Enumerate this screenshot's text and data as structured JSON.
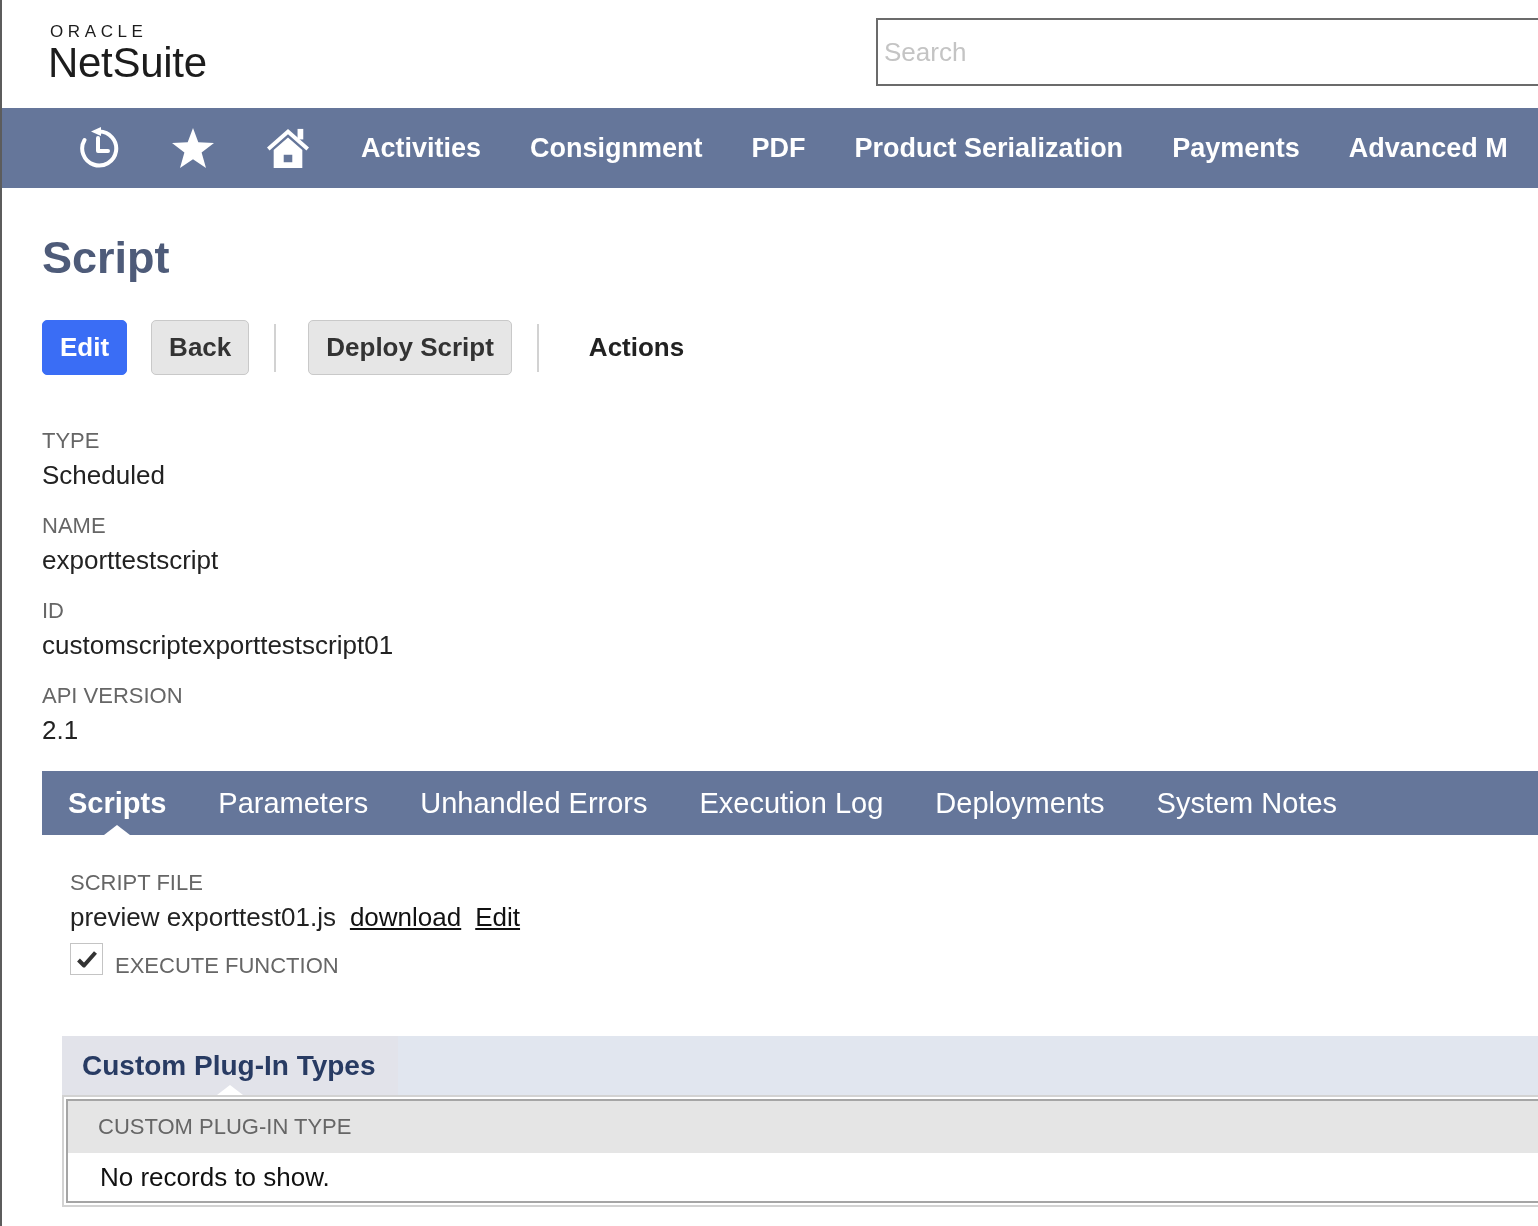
{
  "logo": {
    "company": "ORACLE",
    "product": "NetSuite"
  },
  "search": {
    "placeholder": "Search"
  },
  "nav": {
    "items": [
      "Activities",
      "Consignment",
      "PDF",
      "Product Serialization",
      "Payments",
      "Advanced M"
    ]
  },
  "page": {
    "title": "Script"
  },
  "buttons": [
    {
      "label": "Edit",
      "kind": "primary",
      "separated": false
    },
    {
      "label": "Back",
      "kind": "secondary",
      "separated": false
    },
    {
      "label": "Deploy Script",
      "kind": "secondary",
      "separated": true
    },
    {
      "label": "Actions",
      "kind": "menu",
      "separated": true
    }
  ],
  "fields": [
    {
      "label": "TYPE",
      "value": "Scheduled"
    },
    {
      "label": "NAME",
      "value": "exporttestscript"
    },
    {
      "label": "ID",
      "value": "customscriptexporttestscript01"
    },
    {
      "label": "API VERSION",
      "value": "2.1"
    }
  ],
  "subtabs": [
    {
      "label": "Scripts",
      "selected": true
    },
    {
      "label": "Parameters",
      "selected": false
    },
    {
      "label": "Unhandled Errors",
      "selected": false
    },
    {
      "label": "Execution Log",
      "selected": false
    },
    {
      "label": "Deployments",
      "selected": false
    },
    {
      "label": "System Notes",
      "selected": false
    }
  ],
  "script_file": {
    "label": "SCRIPT FILE",
    "value": "preview exporttest01.js",
    "links": [
      "download",
      "Edit"
    ]
  },
  "execute_function": {
    "label": "EXECUTE FUNCTION",
    "checked": true
  },
  "plugin_section": {
    "tabs": [
      {
        "label": "Custom Plug-In Types",
        "selected": true
      }
    ],
    "table": {
      "columns": [
        "CUSTOM PLUG-IN TYPE"
      ],
      "empty_message": "No records to show."
    }
  }
}
